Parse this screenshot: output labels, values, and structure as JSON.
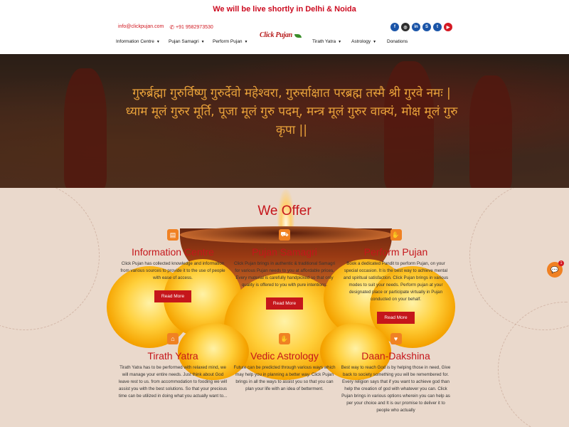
{
  "announcement": "We will be live shortly in Delhi & Noida",
  "contact": {
    "email": "info@clickpujan.com",
    "phone": "+91 9582973530"
  },
  "social": [
    {
      "name": "facebook-icon",
      "glyph": "f"
    },
    {
      "name": "instagram-icon",
      "glyph": "◎"
    },
    {
      "name": "linkedin-icon",
      "glyph": "in"
    },
    {
      "name": "skype-icon",
      "glyph": "S"
    },
    {
      "name": "twitter-icon",
      "glyph": "t"
    },
    {
      "name": "youtube-icon",
      "glyph": "▶"
    }
  ],
  "logo": {
    "text": "Click Pujan",
    "tagline": ""
  },
  "nav": {
    "information": "Information Centre",
    "samagri": "Pujan Samagri",
    "perform": "Perform Pujan",
    "tirath": "Tirath Yatra",
    "astrology": "Astrology",
    "donations": "Donations"
  },
  "hero": {
    "mantra": "गुरुर्ब्रह्मा गुरुर्विष्णु गुरुर्देवो महेश्वरा, गुरुर्साक्षात परब्रह्म तस्मै श्री गुरवे नमः | ध्याम मूलं गुरुर मूर्ति, पूजा मूलं गुरु पदम्, मन्त्र मूलं गुरुर वाक्यं, मोक्ष मूलं गुरु कृपा ||"
  },
  "offer": {
    "title": "We Offer",
    "cards": [
      {
        "title": "Information Centre",
        "text": "Click Pujan has collected knowledge and information from various sources to provide it to the use of people with ease of access.",
        "button": "Read More"
      },
      {
        "title": "Pujan Samagri",
        "text": "Click Pujan brings in authentic & traditional Samagri for various Pujan needs to you at affordable prices. Every material is carefully handpicked so that only quality is offered to you with pure intentions.",
        "button": "Read More"
      },
      {
        "title": "Perform Pujan",
        "text": "Book a dedicated Pandit to perform Pujan, on your special occasion. It is the best way to achieve mental and spiritual satisfaction. Click Pujan brings in various modes to suit your needs. Perform pujan at your designated place or participate virtually in Pujan conducted on your behalf.",
        "button": "Read More"
      },
      {
        "title": "Tirath Yatra",
        "text": "Tirath Yatra has to be performed with relaxed mind, we will manage your entire needs. Just think about God leave rest to us. from accommodation to fooding we will assist you with the best solutions. So that your precious time can be utilized in doing what you actually want to..."
      },
      {
        "title": "Vedic Astrology",
        "text": "Future can be predicted through various ways which may help you in planning a better way. Click Pujan brings in all the ways to assist you so that you can plan your life with an idea of betterment."
      },
      {
        "title": "Daan-Dakshina",
        "text": "Best way to reach God is by helping those in need, Give back to society something you will be remembered for. Every religion says that if you want to achieve god than help the creation of god with whatever you can. Click Pujan brings in various options wherein you can help as per your choice and It is our promise to deliver it to people who actually"
      }
    ]
  },
  "chat": {
    "badge": "1"
  }
}
